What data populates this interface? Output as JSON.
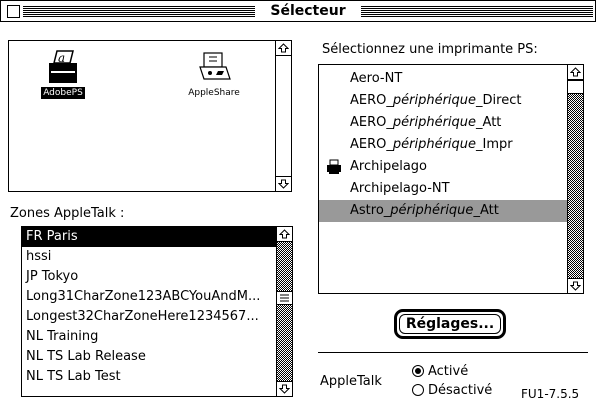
{
  "window": {
    "title": "Sélecteur"
  },
  "drivers": [
    {
      "label": "AdobePS",
      "selected": true,
      "icon": "laser-printer-icon"
    },
    {
      "label": "AppleShare",
      "selected": false,
      "icon": "appleshare-server-icon"
    }
  ],
  "zones": {
    "label": "Zones AppleTalk :",
    "items": [
      "FR Paris",
      "hssi",
      "JP Tokyo",
      "Long31CharZone123ABCYouAndM...",
      "Longest32CharZoneHere1234567...",
      "NL Training",
      "NL TS Lab Release",
      "NL TS Lab Test"
    ],
    "selected_index": 0
  },
  "printers": {
    "label": "Sélectionnez une imprimante PS:",
    "items": [
      {
        "prefix": "Aero-NT",
        "italic": "",
        "suffix": ""
      },
      {
        "prefix": "AERO_",
        "italic": "périphérique",
        "suffix": "_Direct"
      },
      {
        "prefix": "AERO_",
        "italic": "périphérique",
        "suffix": "_Att"
      },
      {
        "prefix": "AERO_",
        "italic": "périphérique",
        "suffix": "_Impr"
      },
      {
        "prefix": "Archipelago",
        "italic": "",
        "suffix": "",
        "icon": "printer-icon"
      },
      {
        "prefix": "Archipelago-NT",
        "italic": "",
        "suffix": ""
      },
      {
        "prefix": "Astro_",
        "italic": "périphérique",
        "suffix": "_Att"
      }
    ],
    "selected_index": 6
  },
  "setup_button": {
    "label": "Réglages..."
  },
  "appletalk": {
    "label": "AppleTalk",
    "options": [
      "Activé",
      "Désactivé"
    ],
    "selected": "Activé"
  },
  "version": "FU1-7.5.5",
  "colors": {
    "selection_black": "#000000",
    "selection_grey": "#999999"
  }
}
